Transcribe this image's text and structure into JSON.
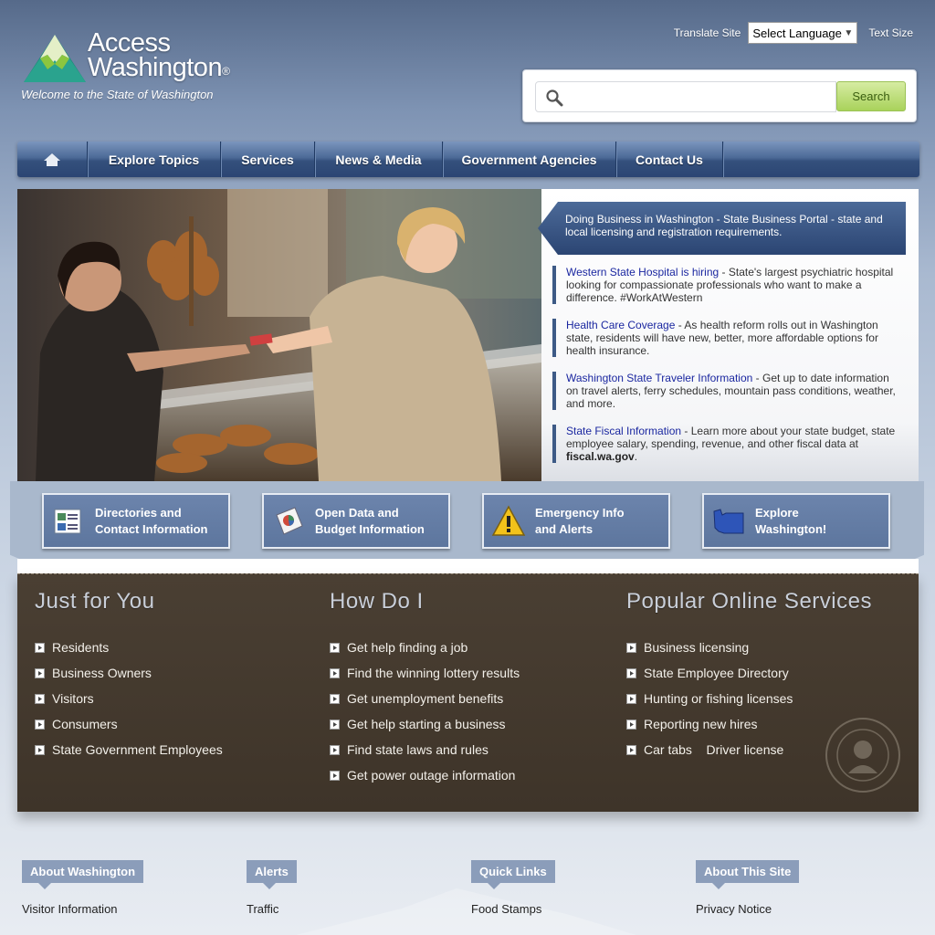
{
  "header": {
    "logo_line1": "Access",
    "logo_line2": "Washington",
    "logo_reg": "®",
    "tagline": "Welcome to the State of Washington",
    "translate_label": "Translate Site",
    "language_select": "Select Language",
    "text_size_label": "Text Size"
  },
  "search": {
    "placeholder": "",
    "button_label": "Search"
  },
  "nav": {
    "items": [
      "Explore Topics",
      "Services",
      "News & Media",
      "Government Agencies",
      "Contact Us"
    ]
  },
  "hero": {
    "feature": "Doing Business in Washington - State Business Portal - state and local licensing and registration requirements.",
    "news": [
      {
        "link": "Western State Hospital is hiring",
        "text": " - State's largest psychiatric hospital looking for compassionate professionals who want to make a difference. #WorkAtWestern"
      },
      {
        "link": "Health Care Coverage",
        "text": " - As health reform rolls out in Washington state, residents will have new, better, more affordable options for health insurance."
      },
      {
        "link": "Washington State Traveler Information",
        "text": " - Get up to date information on travel alerts, ferry schedules, mountain pass conditions, weather, and more."
      },
      {
        "link": "State Fiscal Information",
        "text": " - Learn more about your state budget, state employee salary, spending, revenue, and other fiscal data at ",
        "bold": "fiscal.wa.gov",
        "end": "."
      }
    ]
  },
  "tiles": [
    {
      "line1": "Directories and",
      "line2": "Contact Information",
      "icon": "directory-icon"
    },
    {
      "line1": "Open Data and",
      "line2": "Budget Information",
      "icon": "data-icon"
    },
    {
      "line1": "Emergency Info",
      "line2": "and Alerts",
      "icon": "warning-icon"
    },
    {
      "line1": "Explore",
      "line2": "Washington!",
      "icon": "washington-map-icon"
    }
  ],
  "sections": {
    "just_for_you": {
      "title": "Just for You",
      "items": [
        "Residents",
        "Business Owners",
        "Visitors",
        "Consumers",
        "State Government Employees"
      ]
    },
    "how_do_i": {
      "title": "How Do I",
      "items": [
        "Get help finding a job",
        "Find the winning lottery results",
        "Get unemployment benefits",
        "Get help starting a business",
        "Find state laws and rules",
        "Get power outage information"
      ]
    },
    "popular": {
      "title": "Popular Online Services",
      "items": [
        "Business licensing",
        "State Employee Directory",
        "Hunting or fishing licenses",
        "Reporting new hires",
        "Car tabs    Driver license"
      ]
    }
  },
  "footer": [
    {
      "title": "About Washington",
      "link": "Visitor Information"
    },
    {
      "title": "Alerts",
      "link": "Traffic"
    },
    {
      "title": "Quick Links",
      "link": "Food Stamps"
    },
    {
      "title": "About This Site",
      "link": "Privacy Notice"
    }
  ]
}
